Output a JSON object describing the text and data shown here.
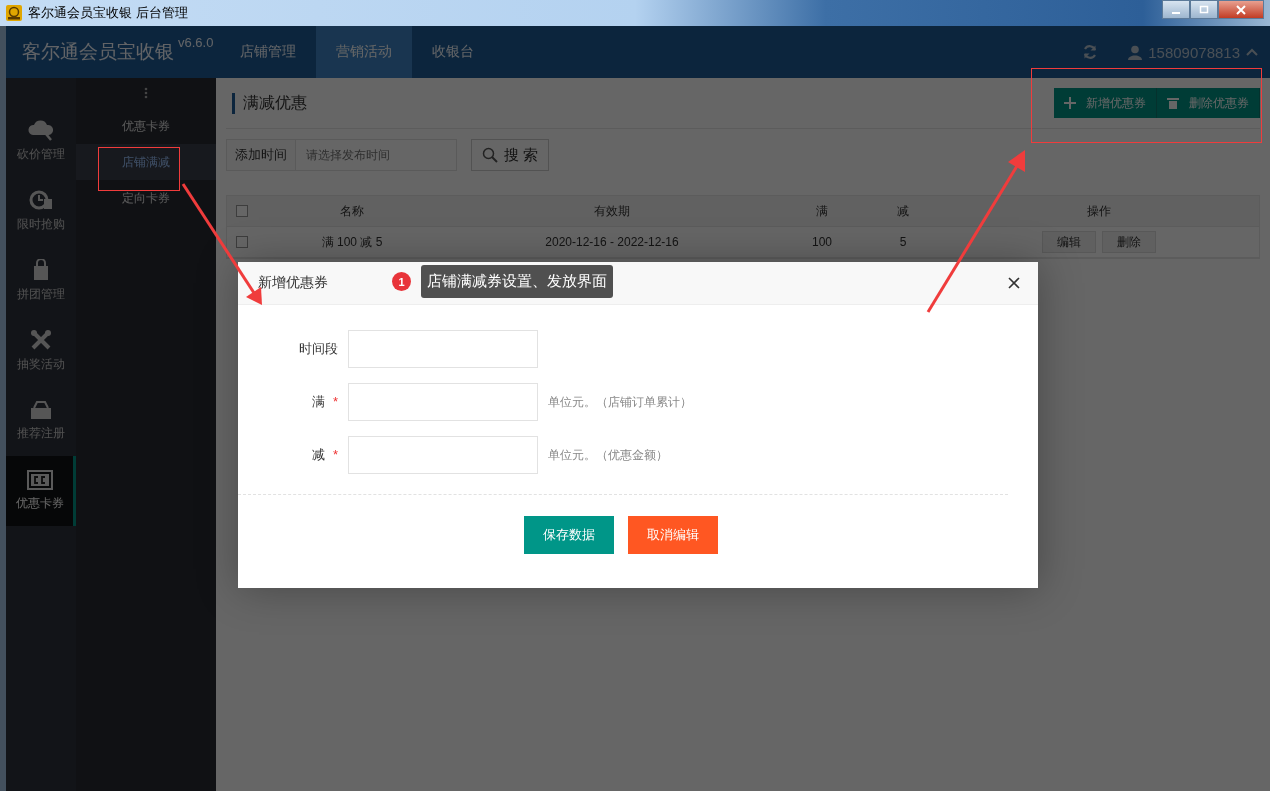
{
  "window": {
    "title": "客尔通会员宝收银 后台管理"
  },
  "header": {
    "brand": "客尔通会员宝收银",
    "version": "v6.6.0",
    "nav": [
      {
        "label": "店铺管理",
        "selected": false
      },
      {
        "label": "营销活动",
        "selected": true
      },
      {
        "label": "收银台",
        "selected": false
      }
    ],
    "user": "15809078813"
  },
  "icon_sidebar": {
    "items": [
      {
        "label": "砍价管理",
        "selected": false
      },
      {
        "label": "限时抢购",
        "selected": false
      },
      {
        "label": "拼团管理",
        "selected": false
      },
      {
        "label": "抽奖活动",
        "selected": false
      },
      {
        "label": "推荐注册",
        "selected": false
      },
      {
        "label": "优惠卡券",
        "selected": true
      }
    ]
  },
  "sub_sidebar": {
    "items": [
      {
        "label": "优惠卡券",
        "selected": false
      },
      {
        "label": "店铺满减",
        "selected": true
      },
      {
        "label": "定向卡券",
        "selected": false
      }
    ]
  },
  "page": {
    "title": "满减优惠",
    "actions": [
      {
        "kind": "add",
        "label": "新增优惠券"
      },
      {
        "kind": "delete",
        "label": "删除优惠券"
      }
    ],
    "filter": {
      "label": "添加时间",
      "placeholder": "请选择发布时间",
      "search_button": "搜 索"
    },
    "table": {
      "header_checked": false,
      "columns": [
        "名称",
        "有效期",
        "满",
        "减",
        "操作"
      ],
      "rows": [
        {
          "checked": false,
          "cells": [
            "满 100 减 5",
            "2020-12-16 - 2022-12-16",
            "100",
            "5"
          ],
          "actions": [
            "编辑",
            "删除"
          ]
        }
      ]
    }
  },
  "modal": {
    "title": "新增优惠券",
    "fields": [
      {
        "label": "时间段"
      },
      {
        "label": "满",
        "required_mark": "*",
        "hint": "单位元。（店铺订单累计）"
      },
      {
        "label": "减",
        "required_mark": "*",
        "hint": "单位元。（优惠金额）"
      }
    ],
    "buttons": [
      {
        "kind": "primary",
        "label": "保存数据"
      },
      {
        "kind": "danger",
        "label": "取消编辑"
      }
    ]
  },
  "annotation": {
    "number": "1",
    "text": "店铺满减券设置、发放界面"
  }
}
